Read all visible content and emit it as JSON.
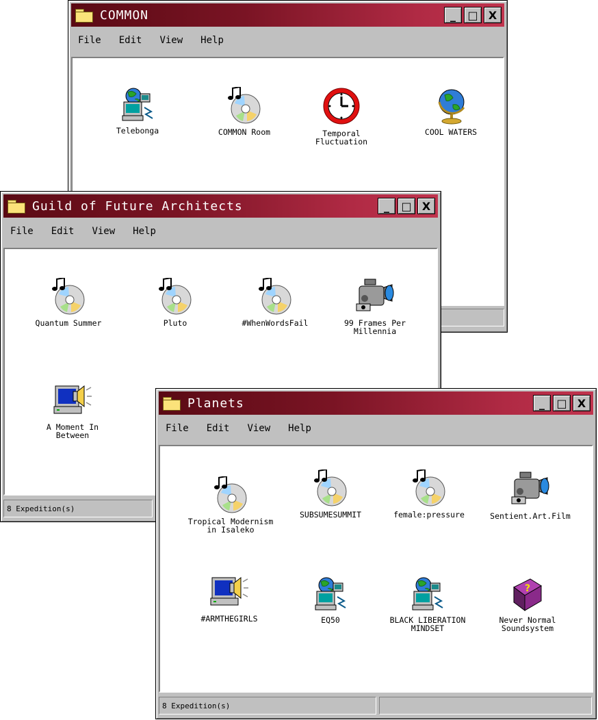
{
  "colors": {
    "titlebar_start": "#5a0a14",
    "titlebar_end": "#c0344e",
    "window": "#c0c0c0",
    "content": "#ffffff"
  },
  "menu": [
    "File",
    "Edit",
    "View",
    "Help"
  ],
  "controls": {
    "minimize": "_",
    "maximize": "□",
    "close": "X"
  },
  "windows": [
    {
      "title": "COMMON",
      "items": [
        {
          "label": "Telebonga",
          "icon": "network-computer-icon"
        },
        {
          "label": "COMMON Room",
          "icon": "music-cd-icon"
        },
        {
          "label": "Temporal Fluctuation",
          "icon": "clock-icon"
        },
        {
          "label": "COOL WATERS",
          "icon": "globe-icon"
        }
      ],
      "status": ""
    },
    {
      "title": "Guild of Future Architects",
      "items": [
        {
          "label": "Quantum Summer",
          "icon": "music-cd-icon"
        },
        {
          "label": "Pluto",
          "icon": "music-cd-icon"
        },
        {
          "label": "#WhenWordsFail",
          "icon": "music-cd-icon"
        },
        {
          "label": "99 Frames Per Millennia",
          "icon": "video-camera-icon"
        },
        {
          "label": "A Moment In Between",
          "icon": "multimedia-computer-icon"
        }
      ],
      "status": "8 Expedition(s)"
    },
    {
      "title": "Planets",
      "items": [
        {
          "label": "Tropical Modernism in Isaleko",
          "icon": "music-cd-icon"
        },
        {
          "label": "SUBSUMESUMMIT",
          "icon": "music-cd-icon"
        },
        {
          "label": "female:pressure",
          "icon": "music-cd-icon"
        },
        {
          "label": "Sentient.Art.Film",
          "icon": "video-camera-icon"
        },
        {
          "label": "#ARMTHEGIRLS",
          "icon": "multimedia-computer-icon"
        },
        {
          "label": "EQ50",
          "icon": "network-computer-icon"
        },
        {
          "label": "BLACK LIBERATION MINDSET",
          "icon": "network-computer-icon"
        },
        {
          "label": "Never Normal Soundsystem",
          "icon": "help-book-icon"
        }
      ],
      "status": "8 Expedition(s)"
    }
  ]
}
